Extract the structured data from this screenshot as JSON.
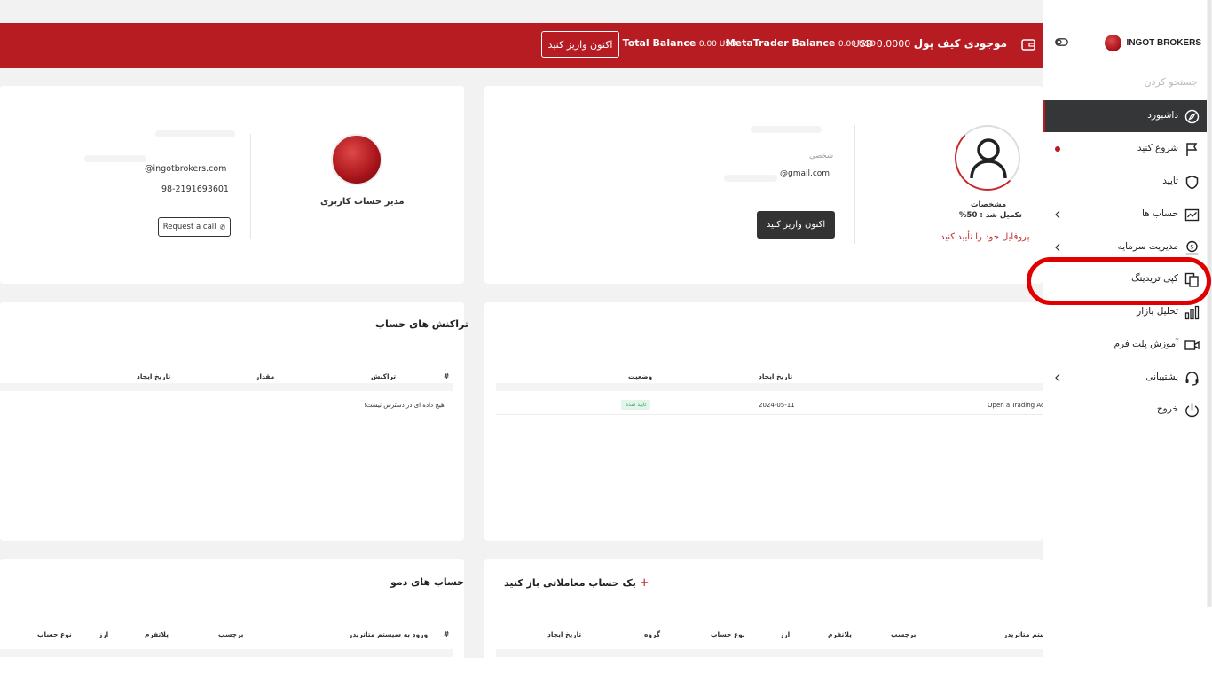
{
  "topbar": {
    "wallet_label": "موجودی کیف پول",
    "wallet_value": "USD 0.0000",
    "mt_label": "MetaTrader Balance",
    "mt_value": "0.00 USD",
    "total_label": "Total Balance",
    "total_value": "0.00 USD",
    "deposit_button": "اکنون واریز کنید"
  },
  "profile": {
    "details_label": "مشخصات",
    "completion": "تکمیل شد : 50%",
    "verify_link": "پروفایل خود را تأیید کنید",
    "type_label": "شخصی",
    "email": "@gmail.com",
    "deposit_button": "اکنون واریز کنید"
  },
  "manager": {
    "title": "مدیر حساب کاربری",
    "email": "@ingotbrokers.com",
    "phone": "98-2191693601",
    "call_button": "Request a call"
  },
  "requests": {
    "headers": {
      "created": "تاریخ ایجاد",
      "status": "وضعیت"
    },
    "row": {
      "type": "Open a Trading Ac",
      "date": "2024-05-11",
      "status": "تایید شده"
    }
  },
  "transactions": {
    "title": "تراکنش های حساب",
    "headers": {
      "hash": "#",
      "transaction": "تراکنش",
      "amount": "مقدار",
      "created": "تاریخ ایجاد"
    },
    "empty": "هیچ داده ای در دسترس نیست!"
  },
  "open_account": {
    "plus": "+",
    "title": "یک حساب معاملاتی باز کنید",
    "headers": {
      "mt": "ستم متاتریدر",
      "label": "برچسب",
      "platform": "پلاتفرم",
      "currency": "ارز",
      "account_type": "نوع حساب",
      "group": "گروه",
      "created": "تاریخ ایجاد"
    }
  },
  "demo": {
    "title": "حساب های دمو",
    "headers": {
      "hash": "#",
      "login": "ورود به سیستم متاتریدر",
      "label": "برچسب",
      "platform": "پلاتفرم",
      "currency": "ارز",
      "account_type": "نوع حساب"
    }
  },
  "sidebar": {
    "brand": "INGOT BROKERS",
    "search_placeholder": "جستجو کردن",
    "items": [
      {
        "label": "داشبورد",
        "icon": "compass-icon"
      },
      {
        "label": "شروع کنید",
        "icon": "flag-icon"
      },
      {
        "label": "تایید",
        "icon": "shield-icon"
      },
      {
        "label": "حساب ها",
        "icon": "chart-window-icon"
      },
      {
        "label": "مدیریت سرمایه",
        "icon": "money-icon"
      },
      {
        "label": "کپی تریدینگ",
        "icon": "copy-icon"
      },
      {
        "label": "تحلیل بازار",
        "icon": "bar-chart-icon"
      },
      {
        "label": "آموزش پلت فرم",
        "icon": "video-icon"
      },
      {
        "label": "پشتیبانی",
        "icon": "headset-icon"
      },
      {
        "label": "خروج",
        "icon": "power-icon"
      }
    ]
  },
  "colors": {
    "brand_red": "#b71c22",
    "active_bg": "#343638",
    "highlight": "#e00000"
  }
}
